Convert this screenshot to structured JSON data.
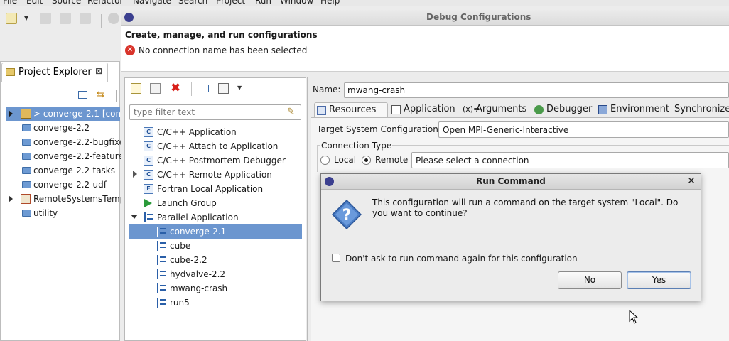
{
  "menubar": {
    "items": [
      "File",
      "Edit",
      "Source",
      "Refactor",
      "Navigate",
      "Search",
      "Project",
      "Run",
      "Window",
      "Help"
    ]
  },
  "project_explorer": {
    "title": "Project Explorer",
    "items": [
      {
        "label": "> converge-2.1  [con",
        "expanded": false,
        "selected": true
      },
      {
        "label": "converge-2.2"
      },
      {
        "label": "converge-2.2-bugfixe"
      },
      {
        "label": "converge-2.2-feature"
      },
      {
        "label": "converge-2.2-tasks"
      },
      {
        "label": "converge-2.2-udf"
      },
      {
        "label": "RemoteSystemsTemp",
        "expanded": false
      },
      {
        "label": "utility"
      }
    ]
  },
  "debug_dialog": {
    "title": "Debug Configurations",
    "header_title": "Create, manage, and run configurations",
    "header_error": "No connection name has been selected",
    "filter_placeholder": "type filter text",
    "config_tree": [
      {
        "label": "C/C++ Application"
      },
      {
        "label": "C/C++ Attach to Application"
      },
      {
        "label": "C/C++ Postmortem Debugger"
      },
      {
        "label": "C/C++ Remote Application"
      },
      {
        "label": "Fortran Local Application"
      },
      {
        "label": "Launch Group"
      },
      {
        "label": "Parallel Application"
      },
      {
        "label": "converge-2.1",
        "selected": true
      },
      {
        "label": "cube"
      },
      {
        "label": "cube-2.2"
      },
      {
        "label": "hydvalve-2.2"
      },
      {
        "label": "mwang-crash"
      },
      {
        "label": "run5"
      }
    ],
    "name_label": "Name:",
    "name_value": "mwang-crash",
    "tabs": [
      "Resources",
      "Application",
      "Arguments",
      "Debugger",
      "Environment",
      "Synchronize"
    ],
    "tsc_label": "Target System Configuration:",
    "tsc_value": "Open MPI-Generic-Interactive",
    "connection_type_label": "Connection Type",
    "radio_local": "Local",
    "radio_remote": "Remote",
    "connection_select": "Please select a connection"
  },
  "run_command": {
    "title": "Run Command",
    "message": "This configuration will run a command on the target system \"Local\". Do you want to continue?",
    "checkbox_label": "Don't ask to run command again for this configuration",
    "no_label": "No",
    "yes_label": "Yes"
  }
}
